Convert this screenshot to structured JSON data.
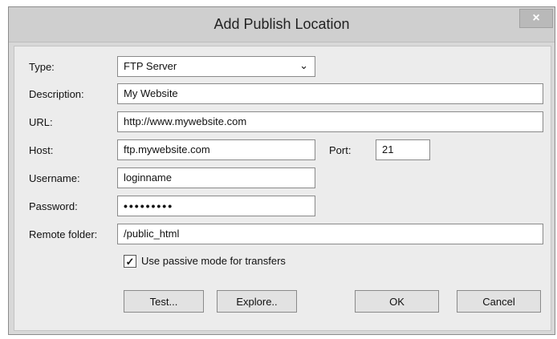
{
  "dialog": {
    "title": "Add Publish Location",
    "close_icon": "close-icon"
  },
  "form": {
    "type_label": "Type:",
    "type_value": "FTP Server",
    "description_label": "Description:",
    "description_value": "My Website",
    "url_label": "URL:",
    "url_value": "http://www.mywebsite.com",
    "host_label": "Host:",
    "host_value": "ftp.mywebsite.com",
    "port_label": "Port:",
    "port_value": "21",
    "username_label": "Username:",
    "username_value": "loginname",
    "password_label": "Password:",
    "password_value": "•••••••••",
    "remote_folder_label": "Remote folder:",
    "remote_folder_value": "/public_html",
    "passive_label": "Use passive mode for transfers",
    "passive_checked": true
  },
  "buttons": {
    "test": "Test...",
    "explore": "Explore..",
    "ok": "OK",
    "cancel": "Cancel"
  }
}
